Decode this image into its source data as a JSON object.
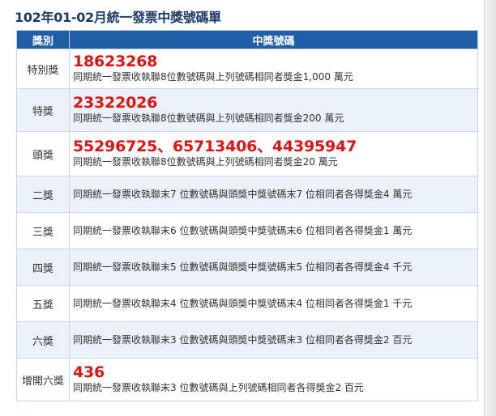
{
  "title": "102年01-02月統一發票中獎號碼單",
  "header": {
    "category": "獎別",
    "numbers": "中獎號碼"
  },
  "rows": [
    {
      "category": "特別獎",
      "number": "18623268",
      "desc": "同期統一發票收執聯8位數號碼與上列號碼相同者獎金1,000 萬元"
    },
    {
      "category": "特獎",
      "number": "23322026",
      "desc": "同期統一發票收執聯8位數號碼與上列號碼相同者獎金200 萬元"
    },
    {
      "category": "頭獎",
      "number": "55296725、65713406、44395947",
      "desc": "同期統一發票收執聯8位數號碼與上列號碼相同者獎金20 萬元"
    },
    {
      "category": "二獎",
      "desc": "同期統一發票收執聯末7 位數號碼與頭獎中獎號碼末7 位相同者各得獎金4 萬元"
    },
    {
      "category": "三獎",
      "desc": "同期統一發票收執聯末6 位數號碼與頭獎中獎號碼末6 位相同者各得獎金1 萬元"
    },
    {
      "category": "四獎",
      "desc": "同期統一發票收執聯末5 位數號碼與頭獎中獎號碼末5 位相同者各得獎金4 千元"
    },
    {
      "category": "五獎",
      "desc": "同期統一發票收執聯末4 位數號碼與頭獎中獎號碼末4 位相同者各得獎金1 千元"
    },
    {
      "category": "六獎",
      "desc": "同期統一發票收執聯末3 位數號碼與頭獎中獎號碼末3 位相同者各得獎金2 百元"
    },
    {
      "category": "增開六獎",
      "number": "436",
      "desc": "同期統一發票收執聯末3 位數號碼與上列號碼相同者各得獎金2 百元"
    }
  ]
}
